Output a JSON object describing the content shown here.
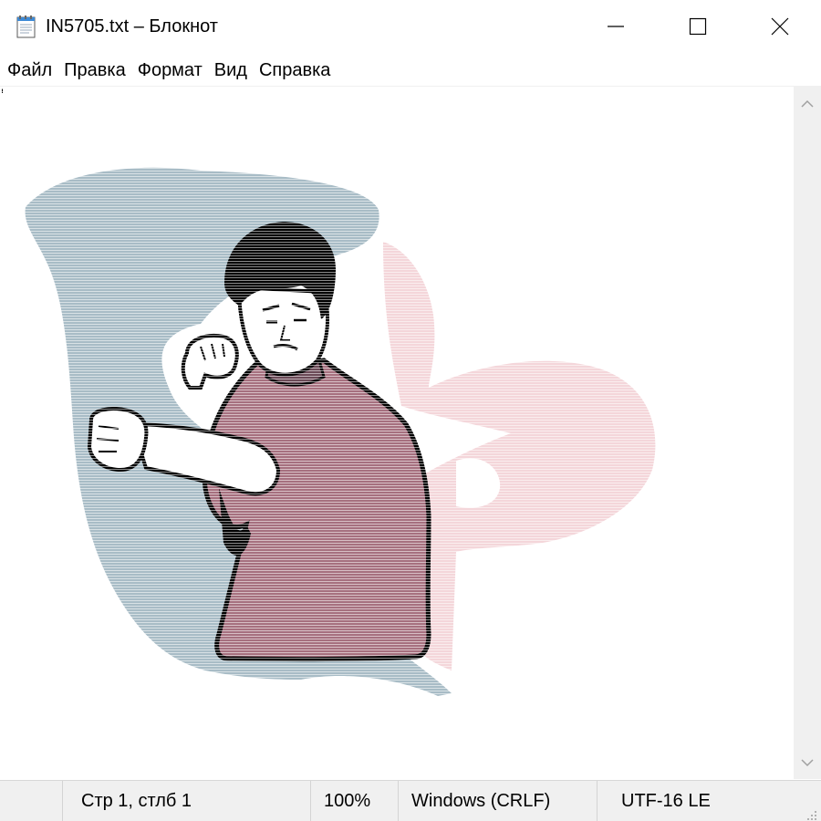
{
  "window": {
    "title": "IN5705.txt – Блокнот",
    "app_icon": "notepad-icon",
    "controls": {
      "minimize_icon": "minimize-icon",
      "maximize_icon": "maximize-icon",
      "close_icon": "close-icon"
    }
  },
  "menu": {
    "items": [
      {
        "label": "Файл"
      },
      {
        "label": "Правка"
      },
      {
        "label": "Формат"
      },
      {
        "label": "Вид"
      },
      {
        "label": "Справка"
      }
    ]
  },
  "editor": {
    "content_description_icon": "fighter-ascii-art",
    "colors": {
      "background_blob": "#a8bcc6",
      "pink_blob": "#f4d6da",
      "shirt": "#a6707f",
      "skin": "#ffffff",
      "outline": "#000000"
    }
  },
  "scrollbar": {
    "up_icon": "chevron-up-icon",
    "down_icon": "chevron-down-icon"
  },
  "status": {
    "position": "Стр 1, стлб 1",
    "zoom": "100%",
    "line_endings": "Windows (CRLF)",
    "encoding": "UTF-16 LE",
    "grip_icon": "resize-grip-icon"
  }
}
